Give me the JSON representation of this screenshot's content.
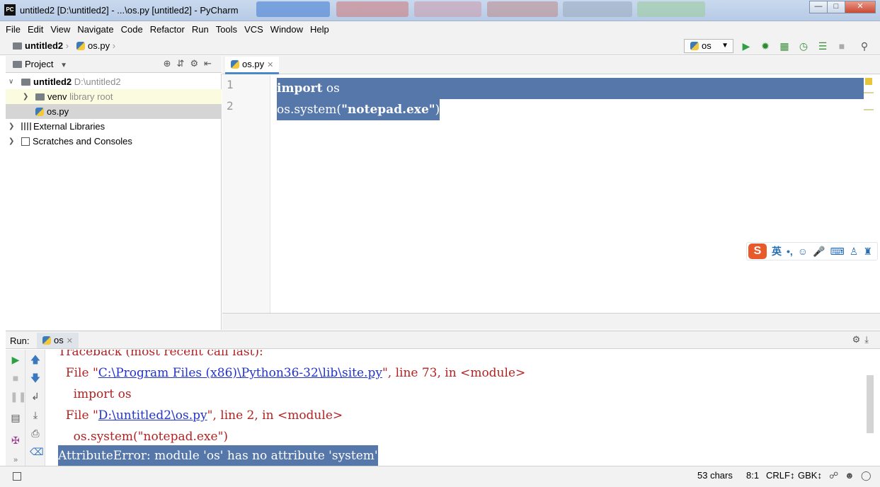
{
  "window": {
    "title": "untitled2 [D:\\untitled2] - ...\\os.py [untitled2] - PyCharm",
    "app_icon": "PC"
  },
  "menu": [
    "File",
    "Edit",
    "View",
    "Navigate",
    "Code",
    "Refactor",
    "Run",
    "Tools",
    "VCS",
    "Window",
    "Help"
  ],
  "breadcrumb": {
    "project": "untitled2",
    "file": "os.py"
  },
  "run_config": "os",
  "project_panel": {
    "title": "Project",
    "tree": {
      "root": {
        "name": "untitled2",
        "path": "D:\\untitled2"
      },
      "venv": {
        "name": "venv",
        "note": "library root"
      },
      "file": "os.py",
      "external": "External Libraries",
      "scratches": "Scratches and Consoles"
    }
  },
  "editor": {
    "tab": "os.py",
    "lines": [
      {
        "num": "1",
        "kw": "import",
        "rest": " os"
      },
      {
        "num": "2",
        "pre": "os.system(",
        "str": "\"notepad.exe\"",
        "post": ")"
      }
    ]
  },
  "ime": {
    "logo": "S",
    "lang": "英"
  },
  "run_panel": {
    "label": "Run:",
    "tab": "os",
    "console": {
      "l1": "Traceback (most recent call last):",
      "l2_pre": "  File \"",
      "l2_link": "C:\\Program Files (x86)\\Python36-32\\lib\\site.py",
      "l2_post": "\", line 73, in <module>",
      "l3": "    import os",
      "l4_pre": "  File \"",
      "l4_link": "D:\\untitled2\\os.py",
      "l4_post": "\", line 2, in <module>",
      "l5": "    os.system(\"notepad.exe\")",
      "l6": "AttributeError: module 'os' has no attribute 'system'"
    }
  },
  "status": {
    "chars": "53 chars",
    "position": "8:1",
    "line_sep": "CRLF↕",
    "encoding": "GBK↕"
  }
}
